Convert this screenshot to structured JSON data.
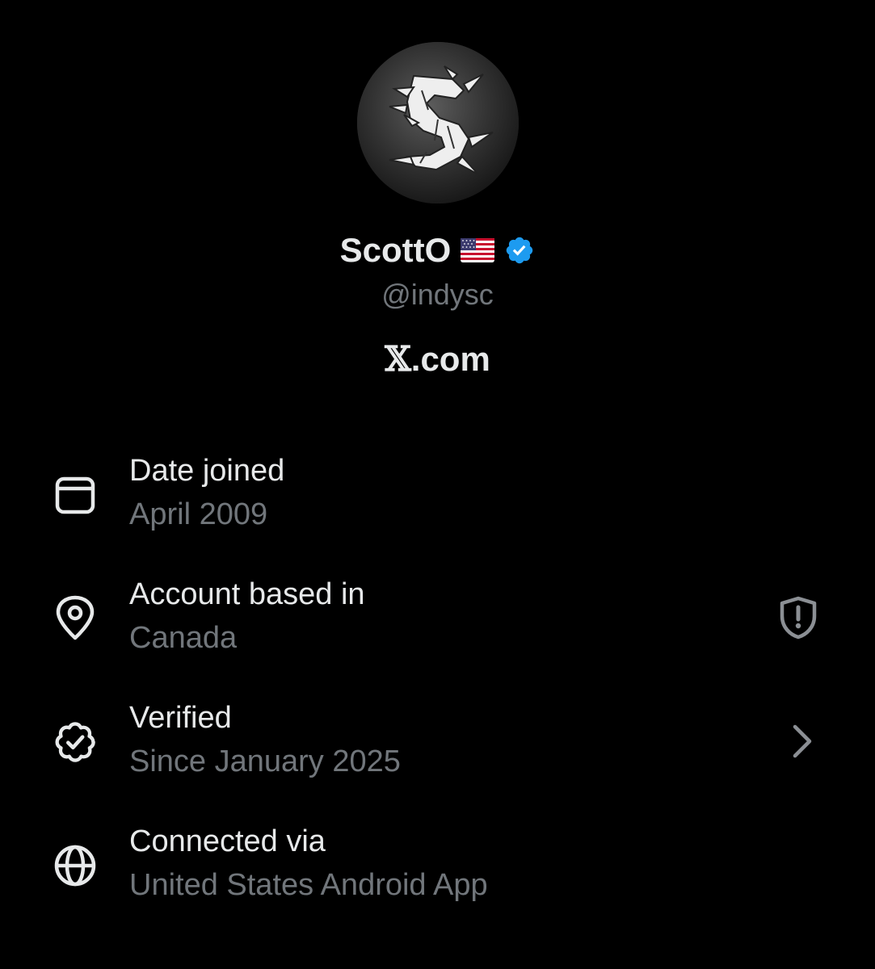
{
  "profile": {
    "display_name": "ScottO",
    "handle": "@indysc",
    "site_prefix": "𝕏",
    "site_suffix": ".com",
    "avatar_icon": "band-logo-avatar",
    "flag_icon": "us-flag-emoji",
    "verified_icon": "verified-badge-icon"
  },
  "info": {
    "date_joined": {
      "label": "Date joined",
      "value": "April 2009",
      "icon": "calendar-icon"
    },
    "based_in": {
      "label": "Account based in",
      "value": "Canada",
      "icon": "location-pin-icon",
      "action_icon": "shield-alert-icon"
    },
    "verified": {
      "label": "Verified",
      "value": "Since January 2025",
      "icon": "verified-seal-icon",
      "action_icon": "chevron-right-icon"
    },
    "connected": {
      "label": "Connected via",
      "value": "United States Android App",
      "icon": "globe-icon"
    }
  },
  "colors": {
    "background": "#000000",
    "primary_text": "#e7e9ea",
    "secondary_text": "#71767b",
    "verified_blue": "#1d9bf0"
  }
}
